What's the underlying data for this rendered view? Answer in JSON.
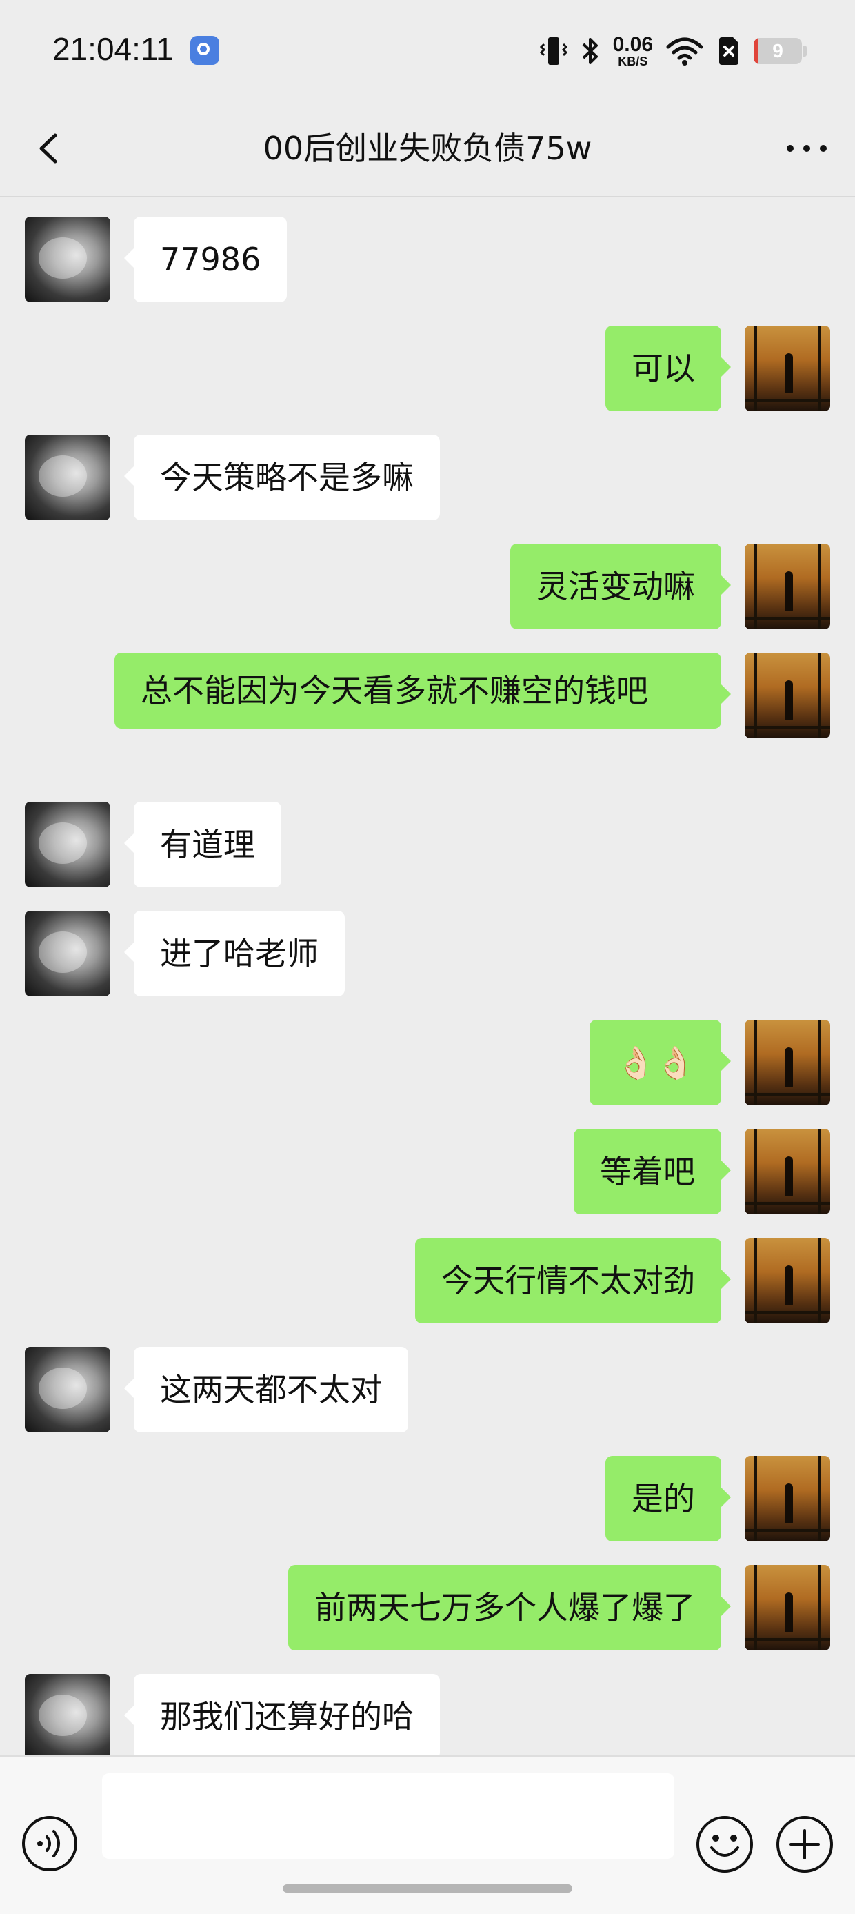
{
  "status_bar": {
    "time": "21:04:11",
    "net_speed_value": "0.06",
    "net_speed_unit": "KB/S",
    "battery": "9",
    "icons": [
      "app-notification-icon",
      "vibrate-icon",
      "bluetooth-icon",
      "wifi-icon",
      "sim-off-icon",
      "battery-icon"
    ]
  },
  "header": {
    "title": "00后创业失败负债75w",
    "back_icon": "chevron-left-icon",
    "more_icon": "more-dots-icon"
  },
  "messages": [
    {
      "side": "left",
      "text": "77986"
    },
    {
      "side": "right",
      "text": "可以"
    },
    {
      "side": "left",
      "text": "今天策略不是多嘛"
    },
    {
      "side": "right",
      "text": "灵活变动嘛"
    },
    {
      "side": "right",
      "text": "总不能因为今天看多就不赚空的钱吧"
    },
    {
      "side": "left",
      "text": "有道理"
    },
    {
      "side": "left",
      "text": "进了哈老师"
    },
    {
      "side": "right",
      "text": "👌🏻👌🏻"
    },
    {
      "side": "right",
      "text": "等着吧"
    },
    {
      "side": "right",
      "text": "今天行情不太对劲"
    },
    {
      "side": "left",
      "text": "这两天都不太对"
    },
    {
      "side": "right",
      "text": "是的"
    },
    {
      "side": "right",
      "text": "前两天七万多个人爆了爆了"
    },
    {
      "side": "left",
      "text": "那我们还算好的哈"
    }
  ],
  "input_bar": {
    "value": "",
    "voice_icon": "voice-icon",
    "emoji_icon": "emoji-icon",
    "plus_icon": "plus-icon"
  },
  "colors": {
    "background": "#ededed",
    "bubble_self": "#95ec69",
    "bubble_other": "#ffffff"
  }
}
